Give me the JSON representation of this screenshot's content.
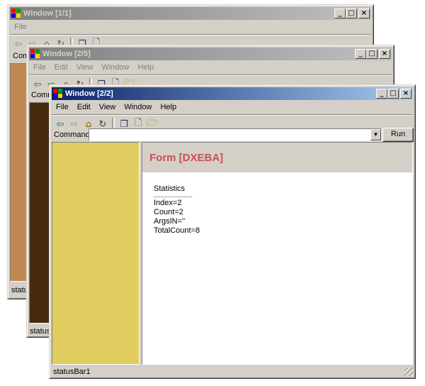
{
  "windows": [
    {
      "title": "Window [1/1]",
      "menu": [
        "File"
      ],
      "command_label": "Comm",
      "statusbar": "status",
      "panel_color": "#c08850"
    },
    {
      "title": "Window [2/5]",
      "menu": [
        "File",
        "Edit",
        "View",
        "Window",
        "Help"
      ],
      "command_label": "Comma",
      "statusbar": "statusB",
      "panel_color": "#462a10"
    },
    {
      "title": "Window [2/2]",
      "menu": [
        "File",
        "Edit",
        "View",
        "Window",
        "Help"
      ],
      "command_label": "Command",
      "command_value": "",
      "run_label": "Run",
      "statusbar": "statusBar1",
      "panel_color": "#e1cc5f",
      "form_title": "Form [DXEBA]",
      "stats": {
        "heading": "Statistics",
        "divider": "......................",
        "index": "Index=2",
        "count": "Count=2",
        "argsin": "ArgsIN=''",
        "totalcount": "TotalCount=8"
      }
    }
  ],
  "colors": {
    "form_title": "#c8505a",
    "form_header_bg": "#d4d0c8",
    "active_titlebar": "#0a246a",
    "inactive_titlebar": "#808080"
  },
  "icons": {
    "back": "back-arrow-icon",
    "forward": "forward-arrow-icon",
    "home": "home-icon",
    "refresh": "refresh-icon",
    "windows": "cascade-windows-icon",
    "new": "new-document-icon",
    "open": "open-folder-icon"
  }
}
